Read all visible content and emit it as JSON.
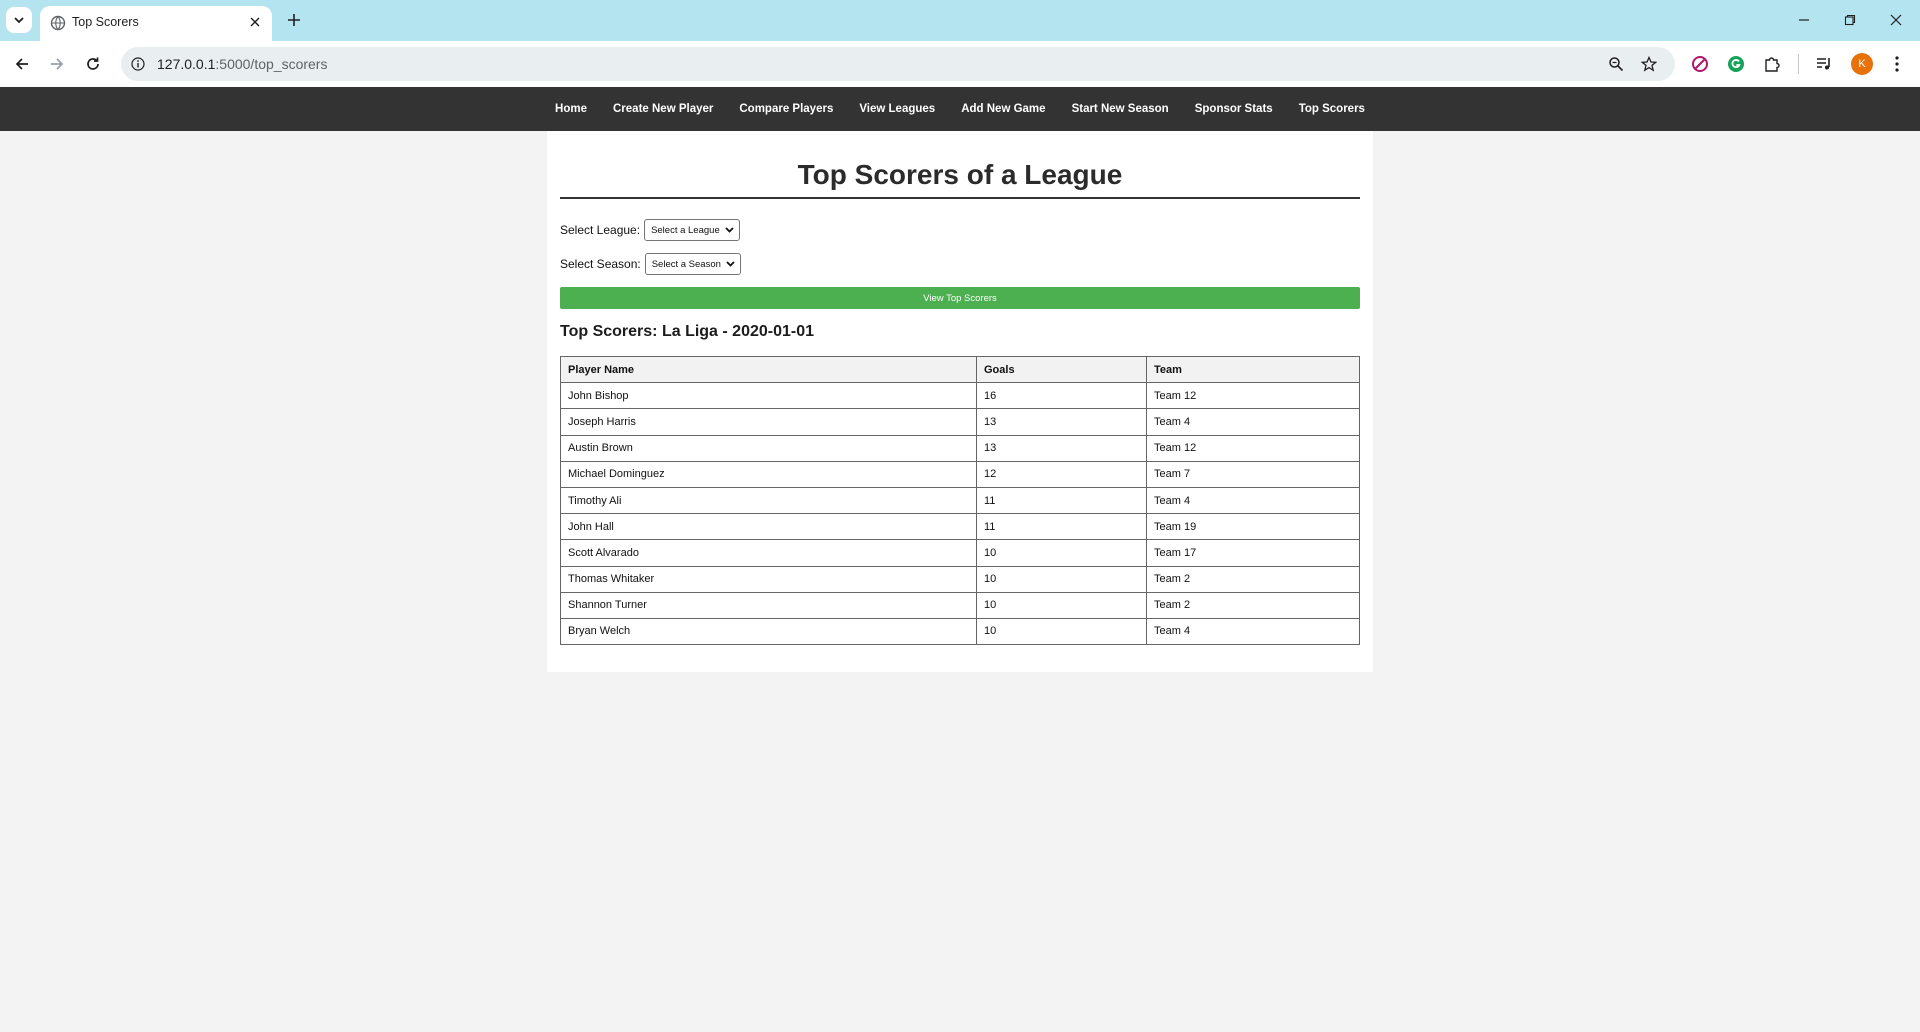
{
  "browser": {
    "tab_title": "Top Scorers",
    "url_host": "127.0.0.1",
    "url_path": ":5000/top_scorers",
    "profile_initial": "K"
  },
  "nav": {
    "items": [
      "Home",
      "Create New Player",
      "Compare Players",
      "View Leagues",
      "Add New Game",
      "Start New Season",
      "Sponsor Stats",
      "Top Scorers"
    ]
  },
  "page": {
    "title": "Top Scorers of a League",
    "league_label": "Select League:",
    "league_value": "Select a League",
    "season_label": "Select Season:",
    "season_value": "Select a Season",
    "submit_label": "View Top Scorers",
    "results_title": "Top Scorers: La Liga - 2020-01-01"
  },
  "table": {
    "headers": [
      "Player Name",
      "Goals",
      "Team"
    ],
    "rows": [
      [
        "John Bishop",
        "16",
        "Team 12"
      ],
      [
        "Joseph Harris",
        "13",
        "Team 4"
      ],
      [
        "Austin Brown",
        "13",
        "Team 12"
      ],
      [
        "Michael Dominguez",
        "12",
        "Team 7"
      ],
      [
        "Timothy Ali",
        "11",
        "Team 4"
      ],
      [
        "John Hall",
        "11",
        "Team 19"
      ],
      [
        "Scott Alvarado",
        "10",
        "Team 17"
      ],
      [
        "Thomas Whitaker",
        "10",
        "Team 2"
      ],
      [
        "Shannon Turner",
        "10",
        "Team 2"
      ],
      [
        "Bryan Welch",
        "10",
        "Team 4"
      ]
    ]
  },
  "colors": {
    "nav_bg": "#333333",
    "button_green": "#4caf50",
    "tabstrip_bg": "#b4e4f0"
  }
}
